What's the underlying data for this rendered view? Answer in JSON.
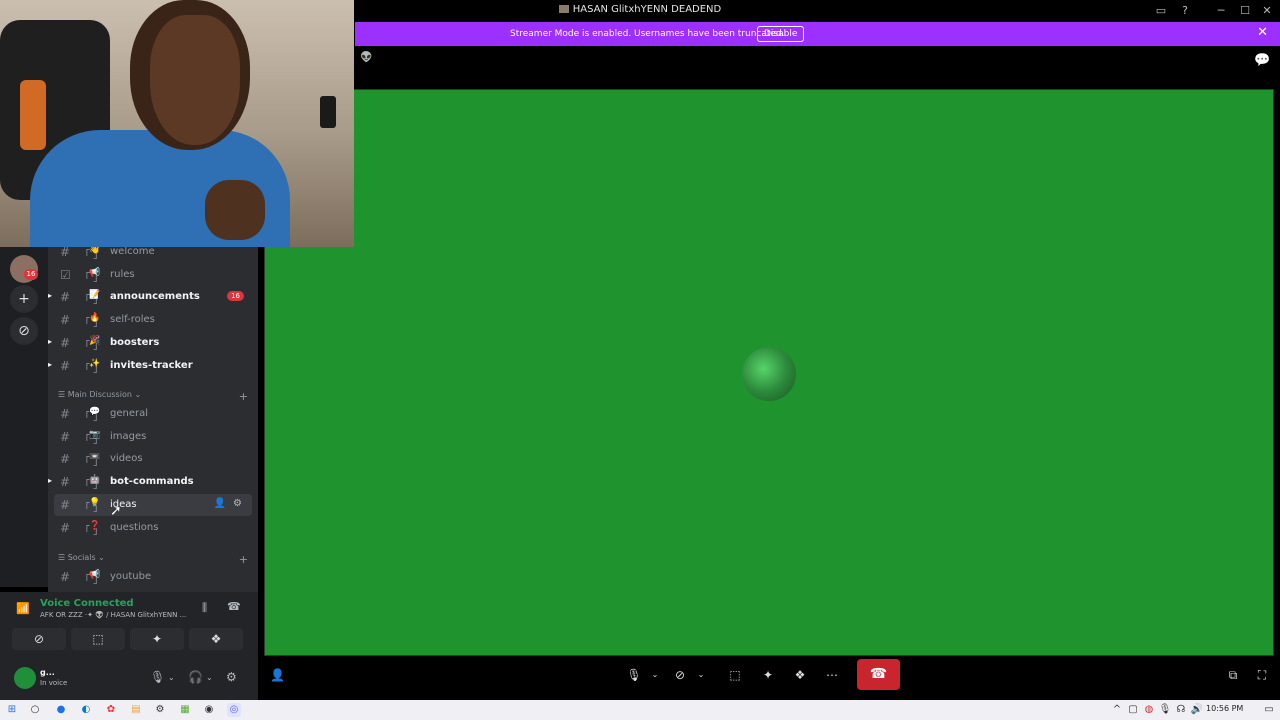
{
  "window": {
    "title": "HASAN GlitxhYENN DEADEND",
    "controls": {
      "inbox": "▭",
      "help": "?",
      "minimize": "─",
      "maximize": "☐",
      "close": "✕"
    }
  },
  "streamer_banner": {
    "text": "Streamer Mode is enabled. Usernames have been truncated.",
    "button": "Disable",
    "close": "✕"
  },
  "server_rail": {
    "badge": "16",
    "add_server": "+",
    "discover": "⊘"
  },
  "channels": [
    {
      "icon": "👋",
      "name": "welcome",
      "unread": false,
      "hash": "#"
    },
    {
      "icon": "📢",
      "name": "rules",
      "unread": false,
      "hash": "☑"
    },
    {
      "icon": "📝",
      "name": "announcements",
      "unread": true,
      "badge": "16",
      "hash": "#"
    },
    {
      "icon": "🔥",
      "name": "self-roles",
      "unread": false,
      "hash": "#"
    },
    {
      "icon": "🎉",
      "name": "boosters",
      "unread": true,
      "hash": "#"
    },
    {
      "icon": "✨",
      "name": "invites-tracker",
      "unread": true,
      "hash": "#"
    }
  ],
  "categories": {
    "main": "Main Discussion",
    "socials": "Socials",
    "plus": "+"
  },
  "main_channels": [
    {
      "icon": "💬",
      "name": "general",
      "unread": false
    },
    {
      "icon": "📷",
      "name": "images",
      "unread": false
    },
    {
      "icon": "📼",
      "name": "videos",
      "unread": false
    },
    {
      "icon": "🤖",
      "name": "bot-commands",
      "unread": true
    },
    {
      "icon": "💡",
      "name": "ideas",
      "unread": false,
      "active": true
    },
    {
      "icon": "❓",
      "name": "questions",
      "unread": false
    }
  ],
  "social_channels": [
    {
      "icon": "📢",
      "name": "youtube",
      "unread": false
    }
  ],
  "bracket": "「  」",
  "voice": {
    "status": "Voice Connected",
    "channel": "AFK OR ZZZ ·✦ 👽 / HASAN GlitxhYENN ...",
    "buttons": [
      "⊘",
      "⬚",
      "✦",
      "❖"
    ]
  },
  "user": {
    "name": "g...",
    "status": "In voice"
  },
  "taskbar": {
    "time": "10:56 PM"
  }
}
